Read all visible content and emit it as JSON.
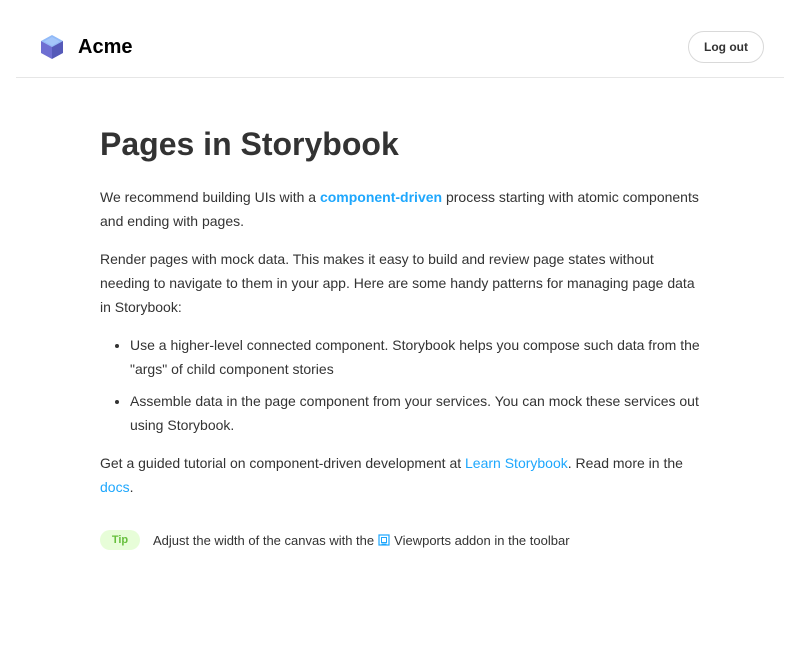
{
  "header": {
    "brand": "Acme",
    "logout_label": "Log out",
    "logo_icon": "storybook-cube-icon",
    "logo_colors": [
      "#FFFFFF",
      "#6E6FD2",
      "#555AB9",
      "#91BAF8"
    ]
  },
  "main": {
    "title": "Pages in Storybook",
    "p1": {
      "before": "We recommend building UIs with a ",
      "link": "component-driven",
      "after": " process starting with atomic components and ending with pages."
    },
    "p2": "Render pages with mock data. This makes it easy to build and review page states without needing to navigate to them in your app. Here are some handy patterns for managing page data in Storybook:",
    "bullets": [
      "Use a higher-level connected component. Storybook helps you compose such data from the \"args\" of child component stories",
      "Assemble data in the page component from your services. You can mock these services out using Storybook."
    ],
    "p3": {
      "before": "Get a guided tutorial on component-driven development at ",
      "link1": "Learn Storybook",
      "middle": ". Read more in the ",
      "link2": "docs",
      "after": "."
    }
  },
  "tip": {
    "badge": "Tip",
    "before": "Adjust the width of the canvas with the ",
    "icon": "viewport-icon",
    "after": "Viewports addon in the toolbar"
  },
  "colors": {
    "link": "#1ea7fd",
    "tip_bg": "#e7fdd8",
    "tip_text": "#66bf3c",
    "text": "#333333"
  }
}
